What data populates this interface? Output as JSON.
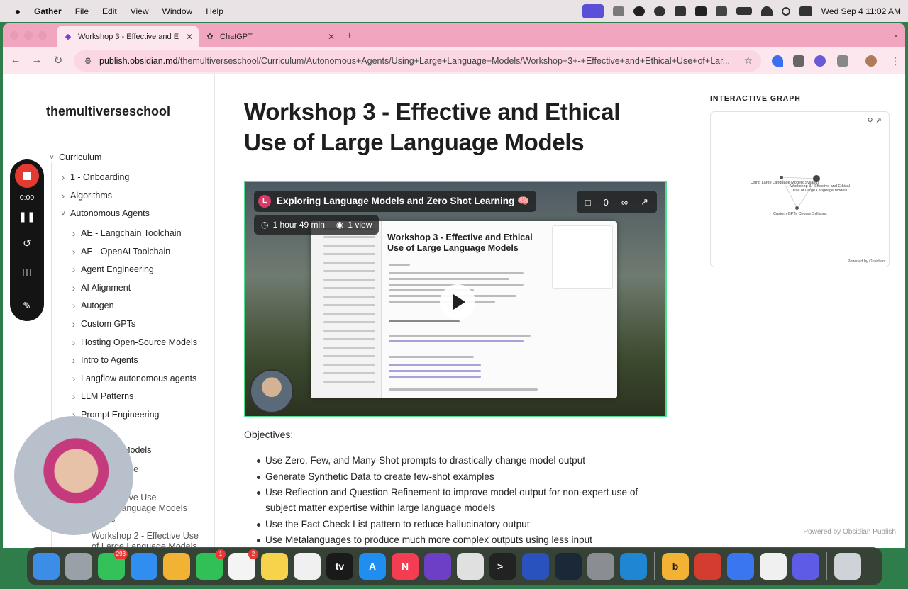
{
  "menubar": {
    "app_name": "Gather",
    "items": [
      "File",
      "Edit",
      "View",
      "Window",
      "Help"
    ],
    "clock": "Wed Sep 4  11:02 AM"
  },
  "browser": {
    "tabs": [
      {
        "title": "Workshop 3 - Effective and E",
        "icon": "obsidian-icon"
      },
      {
        "title": "ChatGPT",
        "icon": "chatgpt-icon"
      }
    ],
    "url_host": "publish.obsidian.md",
    "url_path": "/themultiverseschool/Curriculum/Autonomous+Agents/Using+Large+Language+Models/Workshop+3+-+Effective+and+Ethical+Use+of+Lar..."
  },
  "sidebar": {
    "site_title": "themultiverseschool",
    "tree": [
      {
        "label": "Curriculum",
        "level": 0,
        "state": "open"
      },
      {
        "label": "1 - Onboarding",
        "level": 1,
        "state": "closed"
      },
      {
        "label": "Algorithms",
        "level": 1,
        "state": "closed"
      },
      {
        "label": "Autonomous Agents",
        "level": 1,
        "state": "open"
      },
      {
        "label": "AE - Langchain Toolchain",
        "level": 2,
        "state": "closed"
      },
      {
        "label": "AE - OpenAI Toolchain",
        "level": 2,
        "state": "closed"
      },
      {
        "label": "Agent Engineering",
        "level": 2,
        "state": "closed"
      },
      {
        "label": "AI Alignment",
        "level": 2,
        "state": "closed"
      },
      {
        "label": "Autogen",
        "level": 2,
        "state": "closed"
      },
      {
        "label": "Custom GPTs",
        "level": 2,
        "state": "closed"
      },
      {
        "label": "Hosting Open-Source Models",
        "level": 2,
        "state": "closed"
      },
      {
        "label": "Intro to Agents",
        "level": 2,
        "state": "closed"
      },
      {
        "label": "Langflow autonomous agents",
        "level": 2,
        "state": "closed"
      },
      {
        "label": "LLM Patterns",
        "level": 2,
        "state": "closed"
      },
      {
        "label": "Prompt Engineering",
        "level": 2,
        "state": "closed"
      },
      {
        "label": "h",
        "level": 2,
        "state": "closed"
      },
      {
        "label": "Language Models",
        "level": 2,
        "state": "open"
      },
      {
        "label": "e Language\nlabus",
        "level": 3,
        "state": "none"
      },
      {
        "label": "1 - Effective Use\nLarge Language Models\nstants",
        "level": 3,
        "state": "none"
      },
      {
        "label": "Workshop 2 - Effective Use\nof Large Language Models",
        "level": 3,
        "state": "none"
      }
    ]
  },
  "document": {
    "title": "Workshop 3 - Effective and Ethical Use of Large Language Models",
    "video": {
      "title": "Exploring Language Models and Zero Shot Learning 🧠",
      "avatar_letter": "L",
      "duration": "1 hour 49 min",
      "views": "1 view",
      "comments": "0",
      "inner_title": "Workshop 3 - Effective and Ethical Use of Large Language Models"
    },
    "objectives_heading": "Objectives:",
    "objectives": [
      "Use Zero, Few, and Many-Shot prompts to drastically change model output",
      "Generate Synthetic Data to create few-shot examples",
      "Use Reflection and Question Refinement to improve model output for non-expert use of subject matter expertise within large language models",
      "Use the Fact Check List pattern to reduce hallucinatory output",
      "Use Metalanguages to produce much more complex outputs using less input"
    ]
  },
  "graph": {
    "heading": "INTERACTIVE GRAPH",
    "nodes": [
      "Using Large Language Models Syllabus",
      "Workshop 3 - Effective and Ethical Use of Large Language Models",
      "Custom GPTs Course Syllabus"
    ],
    "powered": "Powered by Obsidian"
  },
  "footer": {
    "powered": "Powered by Obsidian Publish"
  },
  "recorder": {
    "timer": "0:00"
  },
  "dock": {
    "apps": [
      {
        "name": "finder-icon",
        "color": "#3b8de8",
        "glyph": "",
        "badge": ""
      },
      {
        "name": "launchpad-icon",
        "color": "#9aa0a8",
        "glyph": "",
        "badge": ""
      },
      {
        "name": "messages-icon",
        "color": "#33c15a",
        "glyph": "",
        "badge": "293"
      },
      {
        "name": "safari-icon",
        "color": "#2f8ef0",
        "glyph": "",
        "badge": ""
      },
      {
        "name": "photos-icon",
        "color": "#f2b233",
        "glyph": "",
        "badge": ""
      },
      {
        "name": "facetime-icon",
        "color": "#31c057",
        "glyph": "",
        "badge": "1"
      },
      {
        "name": "reminders-icon",
        "color": "#f4f4f4",
        "glyph": "",
        "badge": "2"
      },
      {
        "name": "notes-icon",
        "color": "#f7d34b",
        "glyph": "",
        "badge": ""
      },
      {
        "name": "freeform-icon",
        "color": "#f0f0f0",
        "glyph": "",
        "badge": ""
      },
      {
        "name": "appletv-icon",
        "color": "#1a1a1a",
        "glyph": "tv",
        "badge": ""
      },
      {
        "name": "appstore-icon",
        "color": "#1f8ef0",
        "glyph": "A",
        "badge": ""
      },
      {
        "name": "news-icon",
        "color": "#f43c52",
        "glyph": "N",
        "badge": ""
      },
      {
        "name": "obsidian-icon",
        "color": "#6d3fc6",
        "glyph": "",
        "badge": ""
      },
      {
        "name": "chrome-icon",
        "color": "#e0e0e0",
        "glyph": "",
        "badge": ""
      },
      {
        "name": "terminal-icon",
        "color": "#222222",
        "glyph": ">_",
        "badge": ""
      },
      {
        "name": "network-icon",
        "color": "#2a52be",
        "glyph": "",
        "badge": ""
      },
      {
        "name": "steam-icon",
        "color": "#1b2838",
        "glyph": "",
        "badge": ""
      },
      {
        "name": "settings-icon",
        "color": "#8a8d92",
        "glyph": "",
        "badge": ""
      },
      {
        "name": "vscode-icon",
        "color": "#1f86d4",
        "glyph": "",
        "badge": ""
      },
      {
        "name": "bitcoin-icon",
        "color": "#f2b233",
        "glyph": "b",
        "badge": ""
      },
      {
        "name": "stack-icon",
        "color": "#d43c2f",
        "glyph": "",
        "badge": ""
      },
      {
        "name": "signal-icon",
        "color": "#3a76f0",
        "glyph": "",
        "badge": ""
      },
      {
        "name": "chatgpt-icon",
        "color": "#f0f0f0",
        "glyph": "",
        "badge": ""
      },
      {
        "name": "linear-icon",
        "color": "#5e5ce6",
        "glyph": "",
        "badge": ""
      },
      {
        "name": "trash-icon",
        "color": "#cfd2d6",
        "glyph": "",
        "badge": ""
      }
    ]
  }
}
